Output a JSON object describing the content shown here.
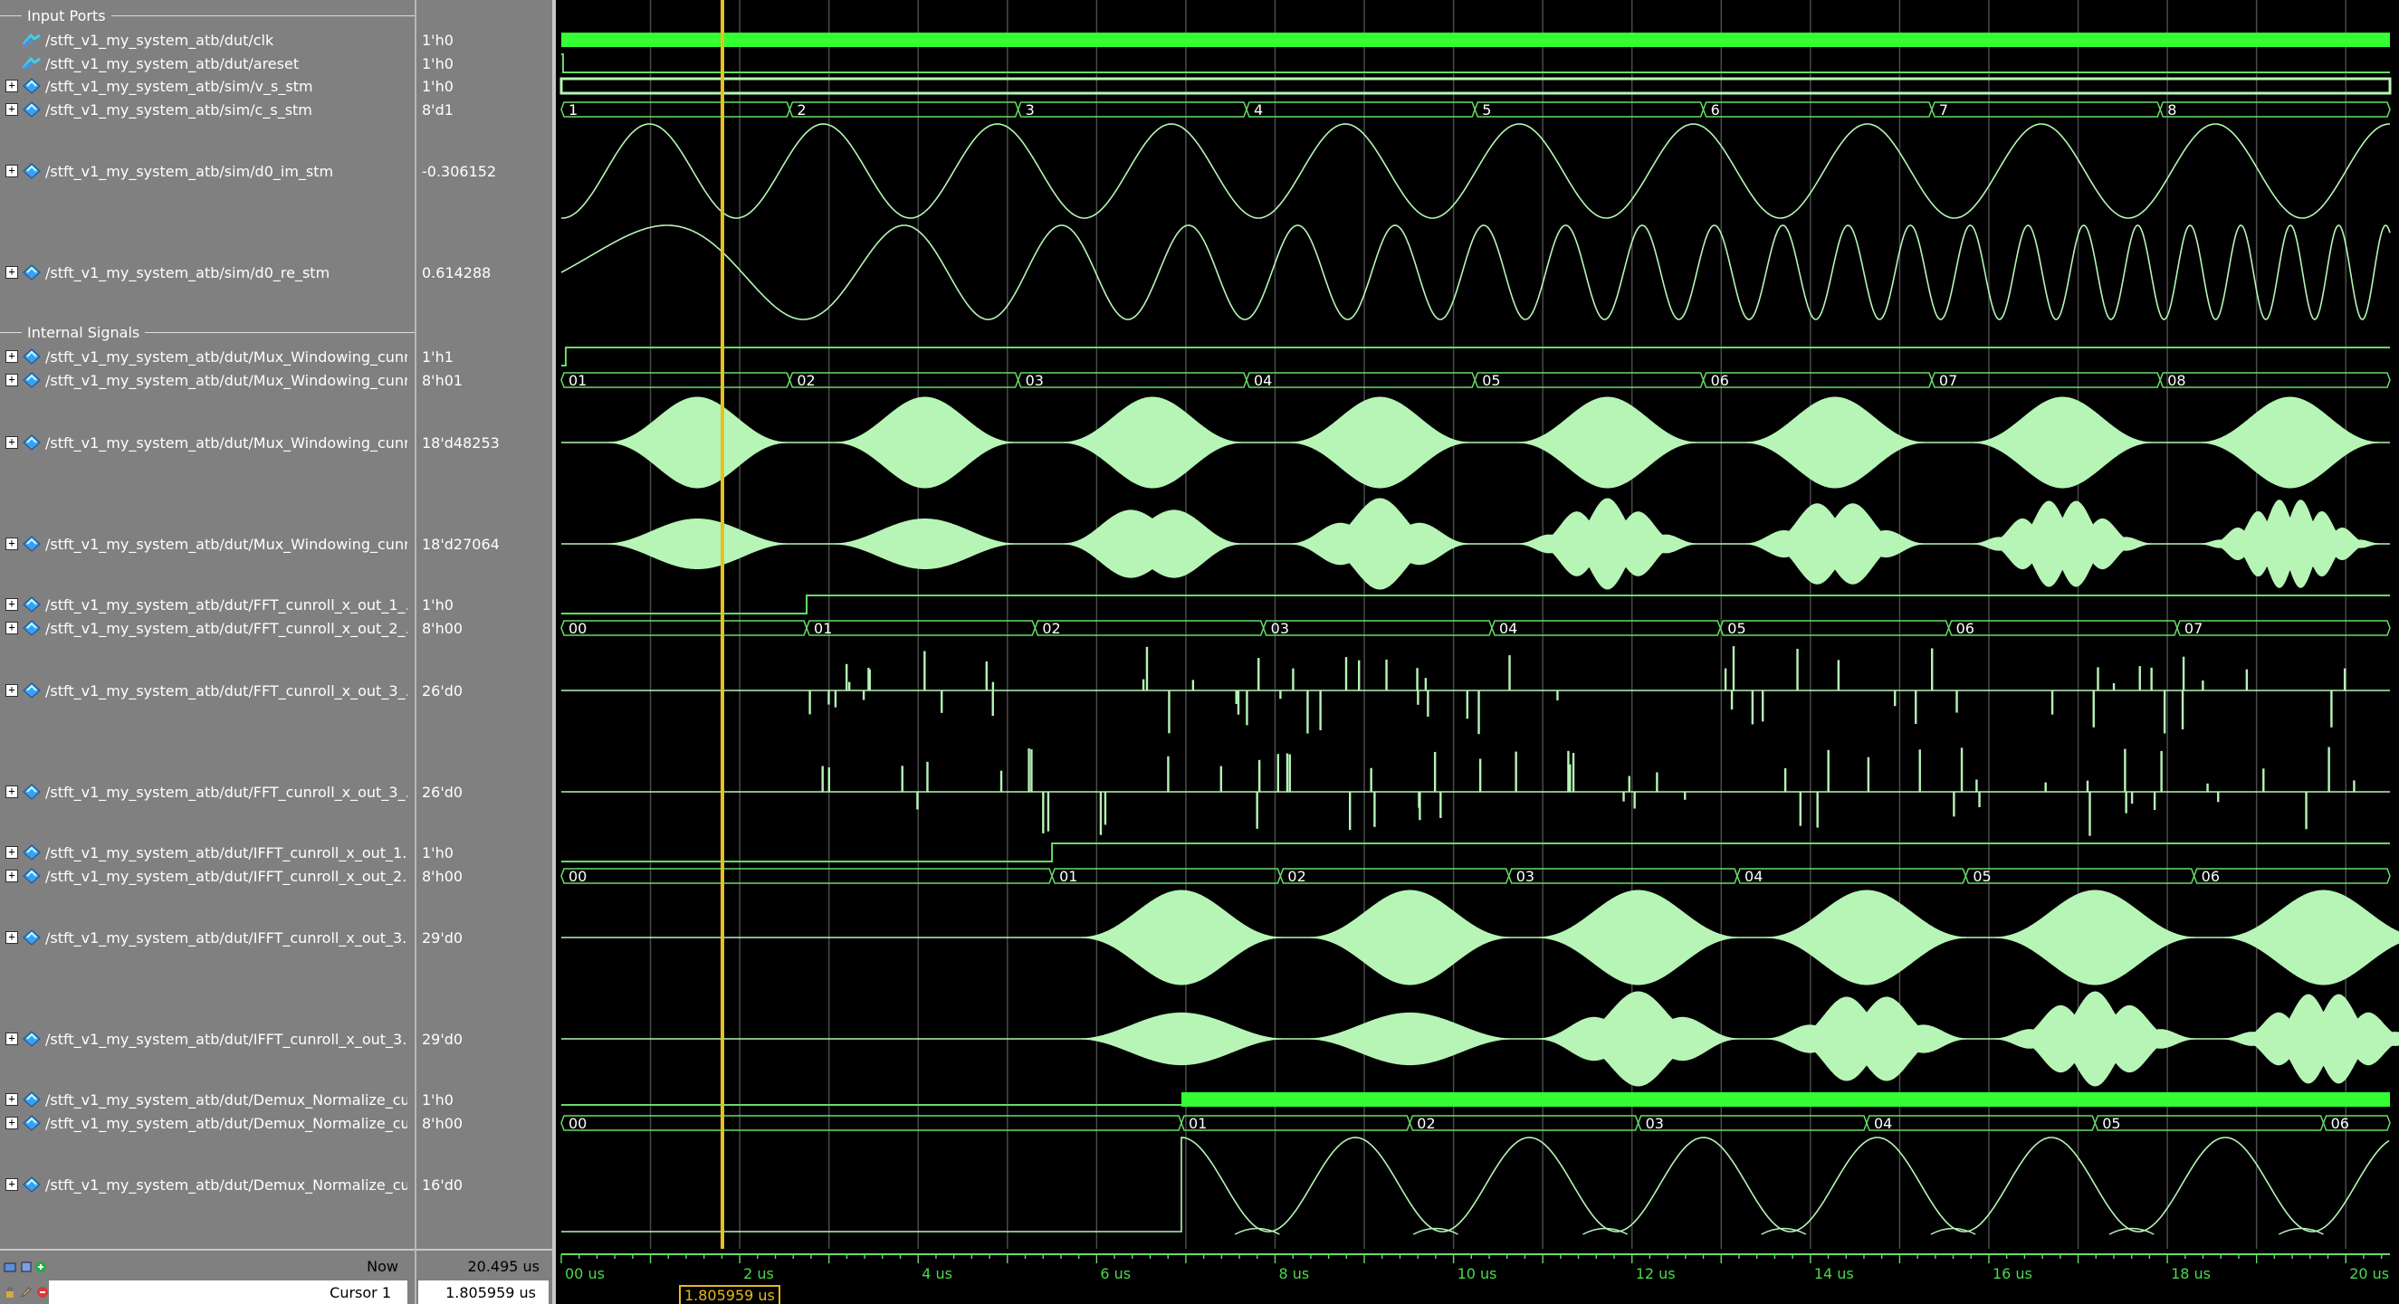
{
  "colors": {
    "wave": "#b6f5b6",
    "line": "#66dd66",
    "bright": "#33ff33",
    "cursor": "#e8c020",
    "grid": "#4a4a4a",
    "panel": "#808080"
  },
  "sections": {
    "inputs": "Input Ports",
    "internal": "Internal Signals"
  },
  "signals": [
    {
      "name": "/stft_v1_my_system_atb/dut/clk",
      "value": "1'h0",
      "icon": "input-port-icon",
      "expandable": false
    },
    {
      "name": "/stft_v1_my_system_atb/dut/areset",
      "value": "1'h0",
      "icon": "input-port-icon",
      "expandable": false
    },
    {
      "name": "/stft_v1_my_system_atb/sim/v_s_stm",
      "value": "1'h0",
      "icon": "signal-icon",
      "expandable": true
    },
    {
      "name": "/stft_v1_my_system_atb/sim/c_s_stm",
      "value": "8'd1",
      "icon": "signal-icon",
      "expandable": true
    },
    {
      "name": "/stft_v1_my_system_atb/sim/d0_im_stm",
      "value": "-0.306152",
      "icon": "signal-icon",
      "expandable": true
    },
    {
      "name": "/stft_v1_my_system_atb/sim/d0_re_stm",
      "value": "0.614288",
      "icon": "signal-icon",
      "expandable": true
    },
    {
      "name": "/stft_v1_my_system_atb/dut/Mux_Windowing_cunr...",
      "value": "1'h1",
      "icon": "signal-icon",
      "expandable": true
    },
    {
      "name": "/stft_v1_my_system_atb/dut/Mux_Windowing_cunr...",
      "value": "8'h01",
      "icon": "signal-icon",
      "expandable": true
    },
    {
      "name": "/stft_v1_my_system_atb/dut/Mux_Windowing_cunr...",
      "value": "18'd48253",
      "icon": "signal-icon",
      "expandable": true
    },
    {
      "name": "/stft_v1_my_system_atb/dut/Mux_Windowing_cunr...",
      "value": "18'd27064",
      "icon": "signal-icon",
      "expandable": true
    },
    {
      "name": "/stft_v1_my_system_atb/dut/FFT_cunroll_x_out_1_...",
      "value": "1'h0",
      "icon": "signal-icon",
      "expandable": true
    },
    {
      "name": "/stft_v1_my_system_atb/dut/FFT_cunroll_x_out_2_...",
      "value": "8'h00",
      "icon": "signal-icon",
      "expandable": true
    },
    {
      "name": "/stft_v1_my_system_atb/dut/FFT_cunroll_x_out_3_...",
      "value": "26'd0",
      "icon": "signal-icon",
      "expandable": true
    },
    {
      "name": "/stft_v1_my_system_atb/dut/FFT_cunroll_x_out_3_...",
      "value": "26'd0",
      "icon": "signal-icon",
      "expandable": true
    },
    {
      "name": "/stft_v1_my_system_atb/dut/IFFT_cunroll_x_out_1...",
      "value": "1'h0",
      "icon": "signal-icon",
      "expandable": true
    },
    {
      "name": "/stft_v1_my_system_atb/dut/IFFT_cunroll_x_out_2...",
      "value": "8'h00",
      "icon": "signal-icon",
      "expandable": true
    },
    {
      "name": "/stft_v1_my_system_atb/dut/IFFT_cunroll_x_out_3...",
      "value": "29'd0",
      "icon": "signal-icon",
      "expandable": true
    },
    {
      "name": "/stft_v1_my_system_atb/dut/IFFT_cunroll_x_out_3...",
      "value": "29'd0",
      "icon": "signal-icon",
      "expandable": true
    },
    {
      "name": "/stft_v1_my_system_atb/dut/Demux_Normalize_cu...",
      "value": "1'h0",
      "icon": "signal-icon",
      "expandable": true
    },
    {
      "name": "/stft_v1_my_system_atb/dut/Demux_Normalize_cu...",
      "value": "8'h00",
      "icon": "signal-icon",
      "expandable": true
    },
    {
      "name": "/stft_v1_my_system_atb/dut/Demux_Normalize_cu...",
      "value": "16'd0",
      "icon": "signal-icon",
      "expandable": true
    }
  ],
  "buses": {
    "c_s_stm": [
      "1",
      "2",
      "3",
      "4",
      "5",
      "6",
      "7",
      "8"
    ],
    "mux_count": [
      "01",
      "02",
      "03",
      "04",
      "05",
      "06",
      "07",
      "08"
    ],
    "fft_count": [
      "00",
      "01",
      "02",
      "03",
      "04",
      "05",
      "06",
      "07"
    ],
    "ifft_count": [
      "00",
      "01",
      "02",
      "03",
      "04",
      "05",
      "06"
    ],
    "demux_count": [
      "00",
      "01",
      "02",
      "03",
      "04",
      "05",
      "06"
    ]
  },
  "status": {
    "now_label": "Now",
    "now_value": "20.495 us",
    "cursor_label": "Cursor 1",
    "cursor_value": "1.805959 us",
    "cursor_tag": "1.805959 us"
  },
  "time_axis": {
    "range_us": [
      0,
      20.495
    ],
    "cursor_us": 1.805959,
    "ticks": [
      "00 us",
      "2 us",
      "4 us",
      "6 us",
      "8 us",
      "10 us",
      "12 us",
      "14 us",
      "16 us",
      "18 us",
      "20 us"
    ]
  }
}
